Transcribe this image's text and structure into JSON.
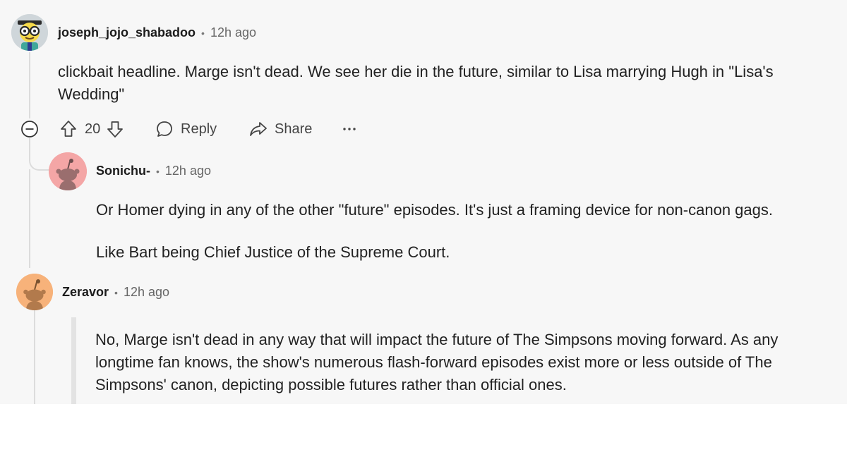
{
  "comments": [
    {
      "author": "joseph_jojo_shabadoo",
      "time": "12h ago",
      "body": [
        "clickbait headline. Marge isn't dead. We see her die in the future, similar to Lisa marrying Hugh in \"Lisa's Wedding\""
      ],
      "avatar_icon": "nerd-character-avatar-icon",
      "actions": {
        "votes": "20",
        "reply": "Reply",
        "share": "Share"
      }
    },
    {
      "author": "Sonichu-",
      "time": "12h ago",
      "body": [
        "Or Homer dying in any of the other \"future\" episodes. It's just a framing device for non-canon gags.",
        "Like Bart being Chief Justice of the Supreme Court."
      ],
      "avatar_icon": "snoo-avatar-icon",
      "avatar_color": "#f4a6a6"
    },
    {
      "author": "Zeravor",
      "time": "12h ago",
      "body": [
        "No, Marge isn't dead in any way that will impact the future of The Simpsons moving forward. As any longtime fan knows, the show's numerous flash-forward episodes exist more or less outside of The Simpsons' canon, depicting possible futures rather than official ones."
      ],
      "avatar_icon": "snoo-avatar-icon",
      "avatar_color": "#f7b27a"
    }
  ],
  "dot_separator": "•"
}
